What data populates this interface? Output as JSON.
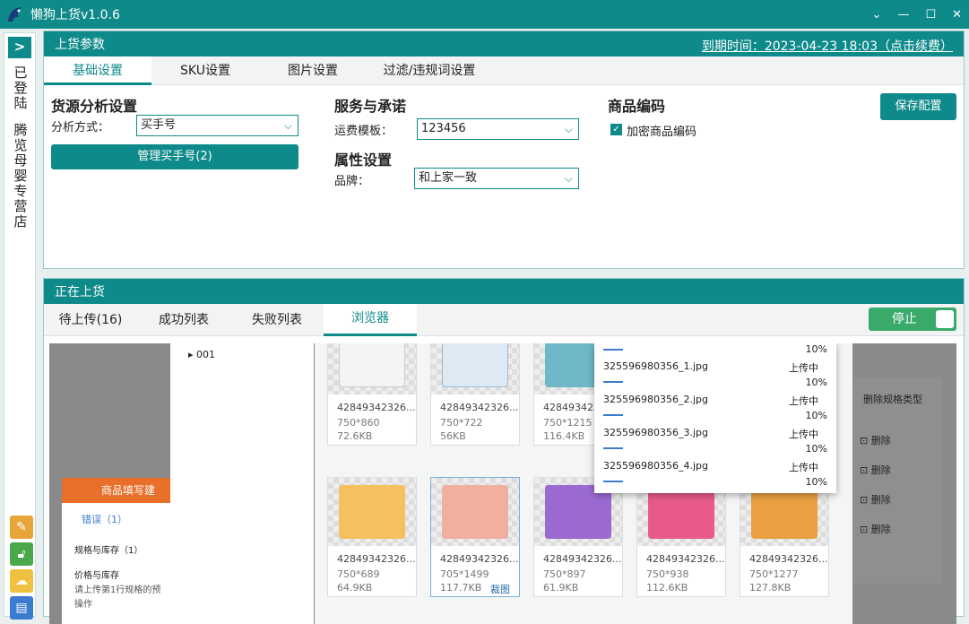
{
  "app": {
    "title": "懒狗上货v1.0.6"
  },
  "window": {
    "minimize": "—",
    "maximize": "☐",
    "close": "✕",
    "dropdown": "⌄"
  },
  "sidebar": {
    "toggle": ">",
    "status": "已登陆",
    "store": "腾览母婴专营店",
    "buttons": [
      {
        "icon": "edit-icon",
        "color": "#e8a53a"
      },
      {
        "icon": "unlock-icon",
        "color": "#4aa84a"
      },
      {
        "icon": "cloud-icon",
        "color": "#f0c040"
      },
      {
        "icon": "store-icon",
        "color": "#3b7bd0"
      }
    ]
  },
  "params_panel": {
    "title": "上货参数",
    "expire": "到期时间：2023-04-23 18:03（点击续费）",
    "tabs": [
      "基础设置",
      "SKU设置",
      "图片设置",
      "过滤/违规词设置"
    ],
    "active_tab": 0,
    "source": {
      "heading": "货源分析设置",
      "method_label": "分析方式：",
      "method_value": "买手号",
      "manage_button": "管理买手号(2)"
    },
    "service": {
      "heading": "服务与承诺",
      "freight_label": "运费模板：",
      "freight_value": "123456"
    },
    "attr": {
      "heading": "属性设置",
      "brand_label": "品牌：",
      "brand_value": "和上家一致"
    },
    "encode": {
      "heading": "商品编码",
      "encrypt_label": "加密商品编码",
      "checked": true
    },
    "save_button": "保存配置"
  },
  "upload_panel": {
    "title": "正在上货",
    "tabs": [
      "待上传(16)",
      "成功列表",
      "失败列表",
      "浏览器"
    ],
    "active_tab": 3,
    "stop_button": "停止"
  },
  "browser": {
    "tree_item": "001",
    "left_form": {
      "header": "商品填写建",
      "tab": "错误（1）",
      "line1": "规格与库存（1）",
      "line2": "价格与库存",
      "line3": "请上传第1行规格的预",
      "line4": "操作"
    },
    "right_form": {
      "header": "删除规格类型",
      "delete": "删除"
    },
    "images": [
      {
        "name": "42849342326...",
        "dim": "750*860",
        "size": "72.6KB",
        "color": "#f4f4f4"
      },
      {
        "name": "42849342326...",
        "dim": "750*722",
        "size": "56KB",
        "color": "#dfe9f3"
      },
      {
        "name": "42849342326...",
        "dim": "750*1215",
        "size": "116.4KB",
        "color": "#6fb8c8"
      },
      {
        "name": "42849342326...",
        "dim": "750*689",
        "size": "64.9KB",
        "color": "#f4c060"
      },
      {
        "name": "42849342326...",
        "dim": "705*1499",
        "size": "117.7KB",
        "crop": "裁图",
        "color": "#f0b0a0"
      },
      {
        "name": "42849342326...",
        "dim": "750*897",
        "size": "61.9KB",
        "color": "#9a6ad0"
      },
      {
        "name": "42849342326...",
        "dim": "750*938",
        "size": "112.6KB",
        "color": "#e85a8a"
      },
      {
        "name": "42849342326...",
        "dim": "750*1277",
        "size": "127.8KB",
        "color": "#e8a040"
      }
    ],
    "uploads": [
      {
        "file": "",
        "status": "",
        "pct": "10%"
      },
      {
        "file": "325596980356_1.jpg",
        "status": "上传中",
        "pct": "10%"
      },
      {
        "file": "325596980356_2.jpg",
        "status": "上传中",
        "pct": "10%"
      },
      {
        "file": "325596980356_3.jpg",
        "status": "上传中",
        "pct": "10%"
      },
      {
        "file": "325596980356_4.jpg",
        "status": "上传中",
        "pct": "10%"
      }
    ]
  }
}
